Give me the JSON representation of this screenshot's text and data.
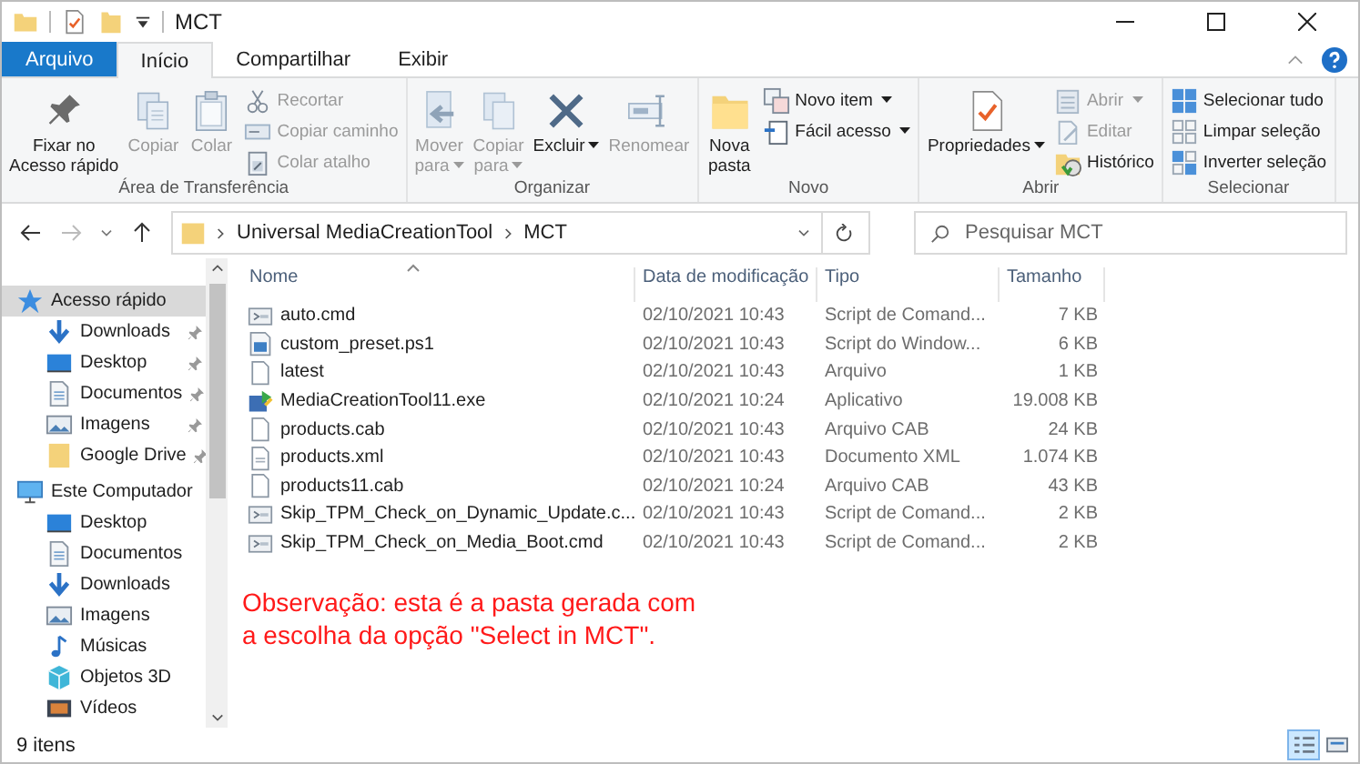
{
  "window": {
    "title": "MCT"
  },
  "ribbon": {
    "tabs": [
      {
        "label": "Arquivo",
        "kind": "file",
        "selected": false
      },
      {
        "label": "Início",
        "kind": "tab",
        "selected": true
      },
      {
        "label": "Compartilhar",
        "kind": "tab",
        "selected": false
      },
      {
        "label": "Exibir",
        "kind": "tab",
        "selected": false
      }
    ],
    "groups": [
      {
        "label": "Área de Transferência",
        "items": [
          {
            "label": "Fixar no\nAcesso rápido",
            "kind": "large",
            "disabled": false,
            "dropdown": false
          },
          {
            "label": "Copiar",
            "kind": "large",
            "disabled": true,
            "dropdown": false
          },
          {
            "label": "Colar",
            "kind": "large",
            "disabled": true,
            "dropdown": false
          },
          {
            "label": "Recortar",
            "kind": "small",
            "disabled": true,
            "dropdown": false
          },
          {
            "label": "Copiar caminho",
            "kind": "small",
            "disabled": true,
            "dropdown": false
          },
          {
            "label": "Colar atalho",
            "kind": "small",
            "disabled": true,
            "dropdown": false
          }
        ]
      },
      {
        "label": "Organizar",
        "items": [
          {
            "label": "Mover\npara",
            "kind": "large",
            "disabled": true,
            "dropdown": true
          },
          {
            "label": "Copiar\npara",
            "kind": "large",
            "disabled": true,
            "dropdown": true
          },
          {
            "label": "Excluir",
            "kind": "large",
            "disabled": false,
            "dropdown": true
          },
          {
            "label": "Renomear",
            "kind": "large",
            "disabled": true,
            "dropdown": false
          }
        ]
      },
      {
        "label": "Novo",
        "items": [
          {
            "label": "Nova\npasta",
            "kind": "large",
            "disabled": false,
            "dropdown": false
          },
          {
            "label": "Novo item",
            "kind": "small",
            "disabled": false,
            "dropdown": true
          },
          {
            "label": "Fácil acesso",
            "kind": "small",
            "disabled": false,
            "dropdown": true
          }
        ]
      },
      {
        "label": "Abrir",
        "items": [
          {
            "label": "Propriedades",
            "kind": "large",
            "disabled": false,
            "dropdown": true
          },
          {
            "label": "Abrir",
            "kind": "small",
            "disabled": true,
            "dropdown": true
          },
          {
            "label": "Editar",
            "kind": "small",
            "disabled": true,
            "dropdown": false
          },
          {
            "label": "Histórico",
            "kind": "small",
            "disabled": false,
            "dropdown": false
          }
        ]
      },
      {
        "label": "Selecionar",
        "items": [
          {
            "label": "Selecionar tudo",
            "kind": "small",
            "disabled": false,
            "dropdown": false
          },
          {
            "label": "Limpar seleção",
            "kind": "small",
            "disabled": false,
            "dropdown": false
          },
          {
            "label": "Inverter seleção",
            "kind": "small",
            "disabled": false,
            "dropdown": false
          }
        ]
      }
    ]
  },
  "address": {
    "path": [
      "Universal MediaCreationTool",
      "MCT"
    ]
  },
  "search": {
    "placeholder": "Pesquisar MCT"
  },
  "sidebar": {
    "items": [
      {
        "label": "Acesso rápido",
        "kind": "star",
        "selected": true,
        "children": [
          {
            "label": "Downloads",
            "kind": "download",
            "pinned": true,
            "selected": false
          },
          {
            "label": "Desktop",
            "kind": "desktop",
            "pinned": true,
            "selected": false
          },
          {
            "label": "Documentos",
            "kind": "documents",
            "pinned": true,
            "selected": false
          },
          {
            "label": "Imagens",
            "kind": "pictures",
            "pinned": true,
            "selected": false
          },
          {
            "label": "Google Drive",
            "kind": "folder",
            "pinned": true,
            "selected": false
          }
        ]
      },
      {
        "label": "Este Computador",
        "kind": "computer",
        "selected": false,
        "children": [
          {
            "label": "Desktop",
            "kind": "desktop",
            "selected": false
          },
          {
            "label": "Documentos",
            "kind": "documents",
            "selected": false
          },
          {
            "label": "Downloads",
            "kind": "download",
            "selected": false
          },
          {
            "label": "Imagens",
            "kind": "pictures",
            "selected": false
          },
          {
            "label": "Músicas",
            "kind": "music",
            "selected": false
          },
          {
            "label": "Objetos 3D",
            "kind": "objects3d",
            "selected": false
          },
          {
            "label": "Vídeos",
            "kind": "videos",
            "selected": false
          }
        ]
      }
    ]
  },
  "table": {
    "columns": [
      "Nome",
      "Data de modificação",
      "Tipo",
      "Tamanho"
    ],
    "rows": [
      {
        "name": "auto.cmd",
        "kind": "script",
        "date": "02/10/2021 10:43",
        "type": "Script de Comand...",
        "size": "7 KB",
        "selected": false
      },
      {
        "name": "custom_preset.ps1",
        "kind": "powershell",
        "date": "02/10/2021 10:43",
        "type": "Script do Window...",
        "size": "6 KB",
        "selected": false
      },
      {
        "name": "latest",
        "kind": "blank",
        "date": "02/10/2021 10:43",
        "type": "Arquivo",
        "size": "1 KB",
        "selected": false
      },
      {
        "name": "MediaCreationTool11.exe",
        "kind": "app",
        "date": "02/10/2021 10:24",
        "type": "Aplicativo",
        "size": "19.008 KB",
        "selected": false
      },
      {
        "name": "products.cab",
        "kind": "blank",
        "date": "02/10/2021 10:43",
        "type": "Arquivo CAB",
        "size": "24 KB",
        "selected": false
      },
      {
        "name": "products.xml",
        "kind": "document",
        "date": "02/10/2021 10:43",
        "type": "Documento XML",
        "size": "1.074 KB",
        "selected": false
      },
      {
        "name": "products11.cab",
        "kind": "blank",
        "date": "02/10/2021 10:24",
        "type": "Arquivo CAB",
        "size": "43 KB",
        "selected": false
      },
      {
        "name": "Skip_TPM_Check_on_Dynamic_Update.c...",
        "kind": "script",
        "date": "02/10/2021 10:43",
        "type": "Script de Comand...",
        "size": "2 KB",
        "selected": false
      },
      {
        "name": "Skip_TPM_Check_on_Media_Boot.cmd",
        "kind": "script",
        "date": "02/10/2021 10:43",
        "type": "Script de Comand...",
        "size": "2 KB",
        "selected": false
      }
    ]
  },
  "note": "Observação: esta é a pasta gerada com\na escolha da opção \"Select in MCT\".",
  "status_bar": {
    "count": "9 itens",
    "views": [
      {
        "kind": "details",
        "selected": true
      },
      {
        "kind": "large",
        "selected": false
      }
    ]
  }
}
